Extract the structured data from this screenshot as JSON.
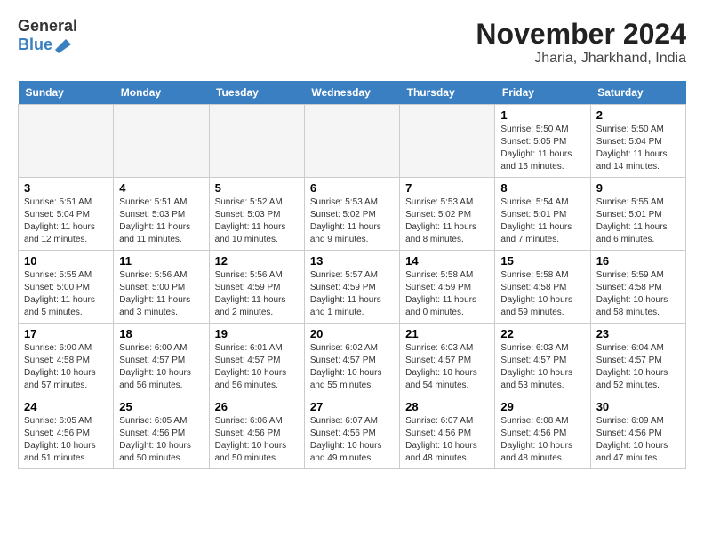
{
  "logo": {
    "general": "General",
    "blue": "Blue"
  },
  "title": "November 2024",
  "subtitle": "Jharia, Jharkhand, India",
  "weekdays": [
    "Sunday",
    "Monday",
    "Tuesday",
    "Wednesday",
    "Thursday",
    "Friday",
    "Saturday"
  ],
  "weeks": [
    [
      {
        "day": "",
        "empty": true
      },
      {
        "day": "",
        "empty": true
      },
      {
        "day": "",
        "empty": true
      },
      {
        "day": "",
        "empty": true
      },
      {
        "day": "",
        "empty": true
      },
      {
        "day": "1",
        "sunrise": "Sunrise: 5:50 AM",
        "sunset": "Sunset: 5:05 PM",
        "daylight": "Daylight: 11 hours and 15 minutes."
      },
      {
        "day": "2",
        "sunrise": "Sunrise: 5:50 AM",
        "sunset": "Sunset: 5:04 PM",
        "daylight": "Daylight: 11 hours and 14 minutes."
      }
    ],
    [
      {
        "day": "3",
        "sunrise": "Sunrise: 5:51 AM",
        "sunset": "Sunset: 5:04 PM",
        "daylight": "Daylight: 11 hours and 12 minutes."
      },
      {
        "day": "4",
        "sunrise": "Sunrise: 5:51 AM",
        "sunset": "Sunset: 5:03 PM",
        "daylight": "Daylight: 11 hours and 11 minutes."
      },
      {
        "day": "5",
        "sunrise": "Sunrise: 5:52 AM",
        "sunset": "Sunset: 5:03 PM",
        "daylight": "Daylight: 11 hours and 10 minutes."
      },
      {
        "day": "6",
        "sunrise": "Sunrise: 5:53 AM",
        "sunset": "Sunset: 5:02 PM",
        "daylight": "Daylight: 11 hours and 9 minutes."
      },
      {
        "day": "7",
        "sunrise": "Sunrise: 5:53 AM",
        "sunset": "Sunset: 5:02 PM",
        "daylight": "Daylight: 11 hours and 8 minutes."
      },
      {
        "day": "8",
        "sunrise": "Sunrise: 5:54 AM",
        "sunset": "Sunset: 5:01 PM",
        "daylight": "Daylight: 11 hours and 7 minutes."
      },
      {
        "day": "9",
        "sunrise": "Sunrise: 5:55 AM",
        "sunset": "Sunset: 5:01 PM",
        "daylight": "Daylight: 11 hours and 6 minutes."
      }
    ],
    [
      {
        "day": "10",
        "sunrise": "Sunrise: 5:55 AM",
        "sunset": "Sunset: 5:00 PM",
        "daylight": "Daylight: 11 hours and 5 minutes."
      },
      {
        "day": "11",
        "sunrise": "Sunrise: 5:56 AM",
        "sunset": "Sunset: 5:00 PM",
        "daylight": "Daylight: 11 hours and 3 minutes."
      },
      {
        "day": "12",
        "sunrise": "Sunrise: 5:56 AM",
        "sunset": "Sunset: 4:59 PM",
        "daylight": "Daylight: 11 hours and 2 minutes."
      },
      {
        "day": "13",
        "sunrise": "Sunrise: 5:57 AM",
        "sunset": "Sunset: 4:59 PM",
        "daylight": "Daylight: 11 hours and 1 minute."
      },
      {
        "day": "14",
        "sunrise": "Sunrise: 5:58 AM",
        "sunset": "Sunset: 4:59 PM",
        "daylight": "Daylight: 11 hours and 0 minutes."
      },
      {
        "day": "15",
        "sunrise": "Sunrise: 5:58 AM",
        "sunset": "Sunset: 4:58 PM",
        "daylight": "Daylight: 10 hours and 59 minutes."
      },
      {
        "day": "16",
        "sunrise": "Sunrise: 5:59 AM",
        "sunset": "Sunset: 4:58 PM",
        "daylight": "Daylight: 10 hours and 58 minutes."
      }
    ],
    [
      {
        "day": "17",
        "sunrise": "Sunrise: 6:00 AM",
        "sunset": "Sunset: 4:58 PM",
        "daylight": "Daylight: 10 hours and 57 minutes."
      },
      {
        "day": "18",
        "sunrise": "Sunrise: 6:00 AM",
        "sunset": "Sunset: 4:57 PM",
        "daylight": "Daylight: 10 hours and 56 minutes."
      },
      {
        "day": "19",
        "sunrise": "Sunrise: 6:01 AM",
        "sunset": "Sunset: 4:57 PM",
        "daylight": "Daylight: 10 hours and 56 minutes."
      },
      {
        "day": "20",
        "sunrise": "Sunrise: 6:02 AM",
        "sunset": "Sunset: 4:57 PM",
        "daylight": "Daylight: 10 hours and 55 minutes."
      },
      {
        "day": "21",
        "sunrise": "Sunrise: 6:03 AM",
        "sunset": "Sunset: 4:57 PM",
        "daylight": "Daylight: 10 hours and 54 minutes."
      },
      {
        "day": "22",
        "sunrise": "Sunrise: 6:03 AM",
        "sunset": "Sunset: 4:57 PM",
        "daylight": "Daylight: 10 hours and 53 minutes."
      },
      {
        "day": "23",
        "sunrise": "Sunrise: 6:04 AM",
        "sunset": "Sunset: 4:57 PM",
        "daylight": "Daylight: 10 hours and 52 minutes."
      }
    ],
    [
      {
        "day": "24",
        "sunrise": "Sunrise: 6:05 AM",
        "sunset": "Sunset: 4:56 PM",
        "daylight": "Daylight: 10 hours and 51 minutes."
      },
      {
        "day": "25",
        "sunrise": "Sunrise: 6:05 AM",
        "sunset": "Sunset: 4:56 PM",
        "daylight": "Daylight: 10 hours and 50 minutes."
      },
      {
        "day": "26",
        "sunrise": "Sunrise: 6:06 AM",
        "sunset": "Sunset: 4:56 PM",
        "daylight": "Daylight: 10 hours and 50 minutes."
      },
      {
        "day": "27",
        "sunrise": "Sunrise: 6:07 AM",
        "sunset": "Sunset: 4:56 PM",
        "daylight": "Daylight: 10 hours and 49 minutes."
      },
      {
        "day": "28",
        "sunrise": "Sunrise: 6:07 AM",
        "sunset": "Sunset: 4:56 PM",
        "daylight": "Daylight: 10 hours and 48 minutes."
      },
      {
        "day": "29",
        "sunrise": "Sunrise: 6:08 AM",
        "sunset": "Sunset: 4:56 PM",
        "daylight": "Daylight: 10 hours and 48 minutes."
      },
      {
        "day": "30",
        "sunrise": "Sunrise: 6:09 AM",
        "sunset": "Sunset: 4:56 PM",
        "daylight": "Daylight: 10 hours and 47 minutes."
      }
    ]
  ]
}
